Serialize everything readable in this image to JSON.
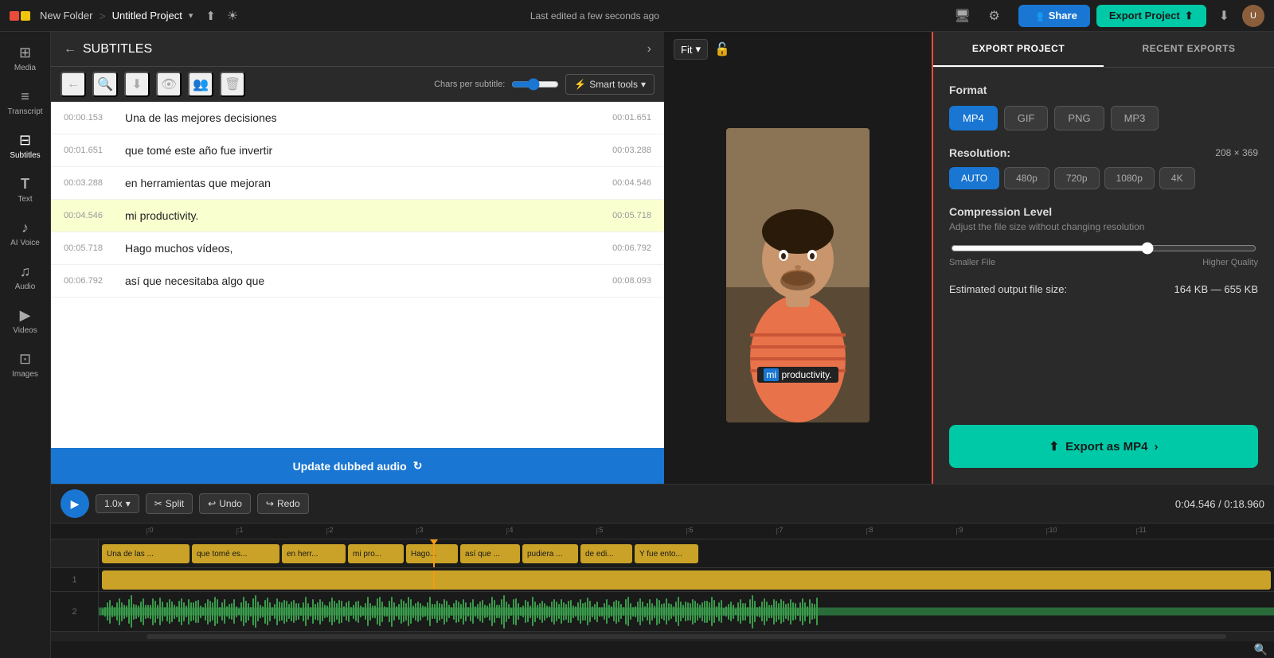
{
  "topbar": {
    "folder_name": "New Folder",
    "separator": ">",
    "project_name": "Untitled Project",
    "chevron": "▾",
    "edit_status": "Last edited a few seconds ago",
    "share_label": "Share",
    "export_top_label": "Export Project",
    "upload_icon": "⬆",
    "settings_icon": "⚙",
    "monitor_icon": "🖥"
  },
  "sidebar": {
    "items": [
      {
        "id": "media",
        "label": "Media",
        "icon": "⊞"
      },
      {
        "id": "transcript",
        "label": "Transcript",
        "icon": "≡"
      },
      {
        "id": "subtitles",
        "label": "Subtitles",
        "icon": "⊟"
      },
      {
        "id": "text",
        "label": "Text",
        "icon": "T"
      },
      {
        "id": "ai-voice",
        "label": "AI Voice",
        "icon": "♪"
      },
      {
        "id": "audio",
        "label": "Audio",
        "icon": "♫"
      },
      {
        "id": "videos",
        "label": "Videos",
        "icon": "▶"
      },
      {
        "id": "images",
        "label": "Images",
        "icon": "⊡"
      }
    ]
  },
  "subtitles_panel": {
    "title": "SUBTITLES",
    "chars_label": "Chars per subtitle:",
    "smart_tools_label": "Smart tools",
    "rows": [
      {
        "start": "00:00.153",
        "text": "Una de las mejores decisiones",
        "end": "00:01.651",
        "active": false
      },
      {
        "start": "00:01.651",
        "text": "que tomé este año fue invertir",
        "end": "00:03.288",
        "active": false
      },
      {
        "start": "00:03.288",
        "text": "en herramientas que mejoran",
        "end": "00:04.546",
        "active": false
      },
      {
        "start": "00:04.546",
        "text": "mi productivity.",
        "end": "00:05.718",
        "active": true
      },
      {
        "start": "00:05.718",
        "text": "Hago muchos vídeos,",
        "end": "00:06.792",
        "active": false
      },
      {
        "start": "00:06.792",
        "text": "así que necesitaba algo que",
        "end": "00:08.093",
        "active": false
      }
    ],
    "update_btn_label": "Update dubbed audio"
  },
  "preview": {
    "fit_label": "Fit",
    "overlay_text": "mi productivity.",
    "overlay_highlight": "mi"
  },
  "export_panel": {
    "tab_export": "EXPORT PROJECT",
    "tab_recent": "RECENT EXPORTS",
    "format_label": "Format",
    "formats": [
      "MP4",
      "GIF",
      "PNG",
      "MP3"
    ],
    "active_format": "MP4",
    "resolution_label": "Resolution:",
    "resolution_value": "208 × 369",
    "resolutions": [
      "AUTO",
      "480p",
      "720p",
      "1080p",
      "4K"
    ],
    "active_resolution": "AUTO",
    "compression_label": "Compression Level",
    "compression_sub": "Adjust the file size without changing resolution",
    "smaller_file_label": "Smaller File",
    "higher_quality_label": "Higher Quality",
    "file_size_label": "Estimated output file size:",
    "file_size_value": "164 KB — 655 KB",
    "export_btn_label": "Export as MP4"
  },
  "timeline": {
    "play_icon": "▶",
    "speed_label": "1.0x",
    "split_label": "Split",
    "undo_label": "Undo",
    "redo_label": "Redo",
    "current_time": "0:04.546",
    "total_time": "0:18.960",
    "ruler_ticks": [
      ":0",
      ":1",
      ":2",
      ":3",
      ":4",
      ":5",
      ":6",
      ":7",
      ":8",
      ":9",
      ":10",
      ":11"
    ],
    "subtitle_clips": [
      {
        "label": "Una de las ..."
      },
      {
        "label": "que tomé es..."
      },
      {
        "label": "en herr..."
      },
      {
        "label": "mi pro..."
      },
      {
        "label": "Hago..."
      },
      {
        "label": "así que ..."
      },
      {
        "label": "pudiera ..."
      },
      {
        "label": "de edi..."
      },
      {
        "label": "Y fue ento..."
      }
    ],
    "track1_label": "1",
    "track2_label": "2"
  }
}
